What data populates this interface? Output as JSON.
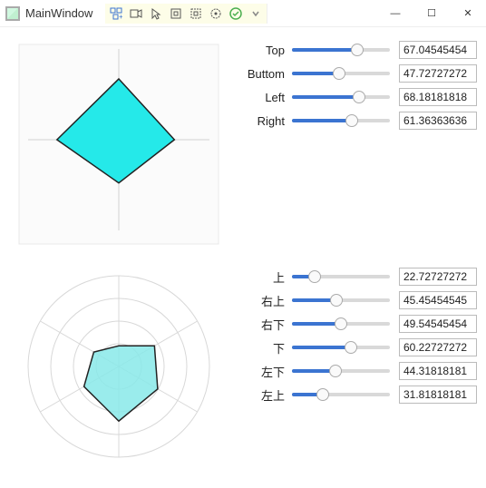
{
  "window_title": "MainWindow",
  "toolbar_icons": [
    "inspect-tree-icon",
    "video-icon",
    "pointer-icon",
    "bounds-icon",
    "layout-icon",
    "target-icon",
    "check-icon",
    "collapse-icon"
  ],
  "chart_a": {
    "axes": [
      "Top",
      "Right",
      "Bottom",
      "Left"
    ],
    "values": [
      67.04545454,
      61.36363636,
      47.72727272,
      68.18181818
    ],
    "max": 100,
    "fill": "#25e9e9",
    "stroke": "#222"
  },
  "chart_b": {
    "axes": [
      "上",
      "右上",
      "右下",
      "下",
      "左下",
      "左上"
    ],
    "values": [
      22.72727272,
      45.45454545,
      49.54545454,
      60.22727272,
      44.31818181,
      31.81818181
    ],
    "rings": 4,
    "max": 100,
    "fill": "#88e9e9",
    "stroke": "#222"
  },
  "sliders_a": [
    {
      "label": "Top",
      "value": 67.04545454,
      "display": "67.04545454"
    },
    {
      "label": "Buttom",
      "value": 47.72727272,
      "display": "47.72727272"
    },
    {
      "label": "Left",
      "value": 68.18181818,
      "display": "68.18181818"
    },
    {
      "label": "Right",
      "value": 61.36363636,
      "display": "61.36363636"
    }
  ],
  "sliders_b": [
    {
      "label": "上",
      "value": 22.72727272,
      "display": "22.72727272"
    },
    {
      "label": "右上",
      "value": 45.45454545,
      "display": "45.45454545"
    },
    {
      "label": "右下",
      "value": 49.54545454,
      "display": "49.54545454"
    },
    {
      "label": "下",
      "value": 60.22727272,
      "display": "60.22727272"
    },
    {
      "label": "左下",
      "value": 44.31818181,
      "display": "44.31818181"
    },
    {
      "label": "左上",
      "value": 31.81818181,
      "display": "31.81818181"
    }
  ],
  "chart_data": [
    {
      "type": "radar",
      "title": "",
      "categories": [
        "Top",
        "Right",
        "Bottom",
        "Left"
      ],
      "series": [
        {
          "name": "",
          "values": [
            67.05,
            61.36,
            47.73,
            68.18
          ]
        }
      ],
      "max": 100
    },
    {
      "type": "radar",
      "title": "",
      "categories": [
        "上",
        "右上",
        "右下",
        "下",
        "左下",
        "左上"
      ],
      "series": [
        {
          "name": "",
          "values": [
            22.73,
            45.45,
            49.55,
            60.23,
            44.32,
            31.82
          ]
        }
      ],
      "max": 100
    }
  ]
}
